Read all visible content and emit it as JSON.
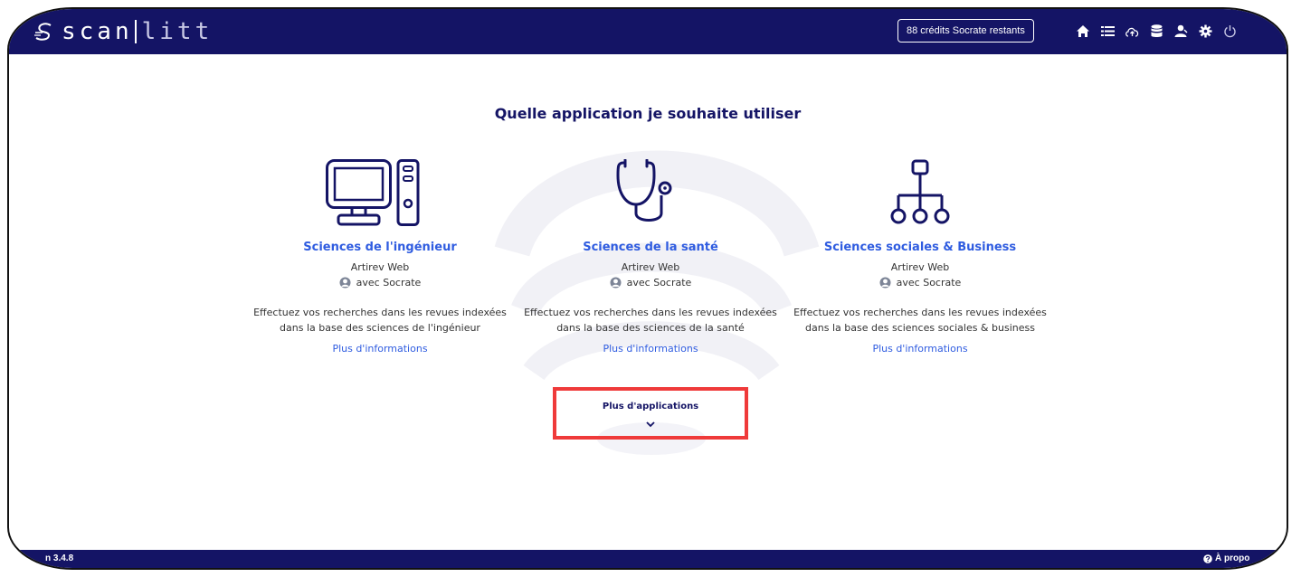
{
  "header": {
    "logo_text_a": "scan",
    "logo_text_b": "litt",
    "credits_label": "88 crédits Socrate restants",
    "icons": [
      "home-icon",
      "list-icon",
      "cloud-upload-icon",
      "database-icon",
      "user-icon",
      "gear-icon",
      "power-icon"
    ]
  },
  "main": {
    "title": "Quelle application je souhaite utiliser",
    "apps": [
      {
        "name": "Sciences de l'ingénieur",
        "subtitle": "Artirev Web",
        "socrate": "avec Socrate",
        "description": "Effectuez vos recherches dans les revues indexées dans la base des sciences de l'ingénieur",
        "more": "Plus d'informations",
        "icon": "computer-icon"
      },
      {
        "name": "Sciences de la santé",
        "subtitle": "Artirev Web",
        "socrate": "avec Socrate",
        "description": "Effectuez vos recherches dans les revues indexées dans la base des sciences de la santé",
        "more": "Plus d'informations",
        "icon": "stethoscope-icon"
      },
      {
        "name": "Sciences sociales & Business",
        "subtitle": "Artirev Web",
        "socrate": "avec Socrate",
        "description": "Effectuez vos recherches dans les revues indexées dans la base des sciences sociales & business",
        "more": "Plus d'informations",
        "icon": "org-chart-icon"
      }
    ],
    "more_apps_label": "Plus d'applications"
  },
  "footer": {
    "version": "n 3.4.8",
    "about": "À propo"
  },
  "colors": {
    "navy": "#141465",
    "link_blue": "#2f5ce0",
    "highlight_red": "#ef3a3a"
  }
}
